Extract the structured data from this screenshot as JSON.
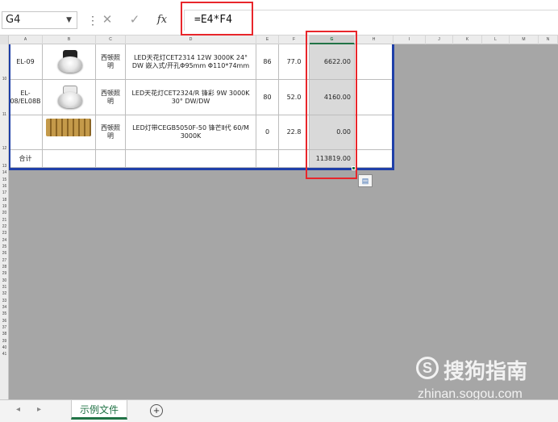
{
  "formula_bar": {
    "name_box": "G4",
    "dropdown_icon": "▼",
    "sep": "⋮",
    "cancel_icon": "✕",
    "enter_icon": "✓",
    "fx_label": "fx",
    "formula": "=E4*F4"
  },
  "columns": [
    "A",
    "B",
    "C",
    "D",
    "E",
    "F",
    "G",
    "H",
    "I",
    "J",
    "K",
    "L",
    "M",
    "N"
  ],
  "selected_column": "G",
  "rows": [
    "10",
    "11",
    "12",
    "13",
    "14",
    "15",
    "16",
    "17",
    "18",
    "19",
    "20",
    "21",
    "22",
    "23",
    "24",
    "25",
    "26",
    "27",
    "28",
    "29",
    "30",
    "31",
    "32",
    "33",
    "34",
    "35",
    "36",
    "37",
    "38",
    "39",
    "40",
    "41"
  ],
  "table": {
    "r10": {
      "a": "EL-09",
      "c": "西顿照明",
      "d": "LED天花灯CET2314 12W 3000K 24° DW 嵌入式/开孔Φ95mm Φ110*74mm",
      "e": "86",
      "f": "77.0",
      "g": "6622.00"
    },
    "r11": {
      "a": "EL-08/EL08B",
      "c": "西顿照明",
      "d": "LED天花灯CET2324/R 锋彩 9W 3000K 30° DW/DW",
      "e": "80",
      "f": "52.0",
      "g": "4160.00"
    },
    "r12": {
      "a": "",
      "c": "西顿照明",
      "d": "LED灯带CEGB5050F-50 锋芒Ⅱ代 60/M 3000K",
      "e": "0",
      "f": "22.8",
      "g": "0.00"
    },
    "r13": {
      "a": "合计",
      "g": "113819.00"
    }
  },
  "sheet_tabs": {
    "prev": "◂",
    "next": "▸",
    "active": "示例文件",
    "add": "+"
  },
  "watermark": {
    "logo": "S",
    "title": "搜狗指南",
    "sub": "zhinan.sogou.com"
  },
  "colors": {
    "accent": "#217346",
    "highlight": "#e8262b",
    "table_border": "#1f3fa8",
    "grey": "#a6a6a6"
  }
}
